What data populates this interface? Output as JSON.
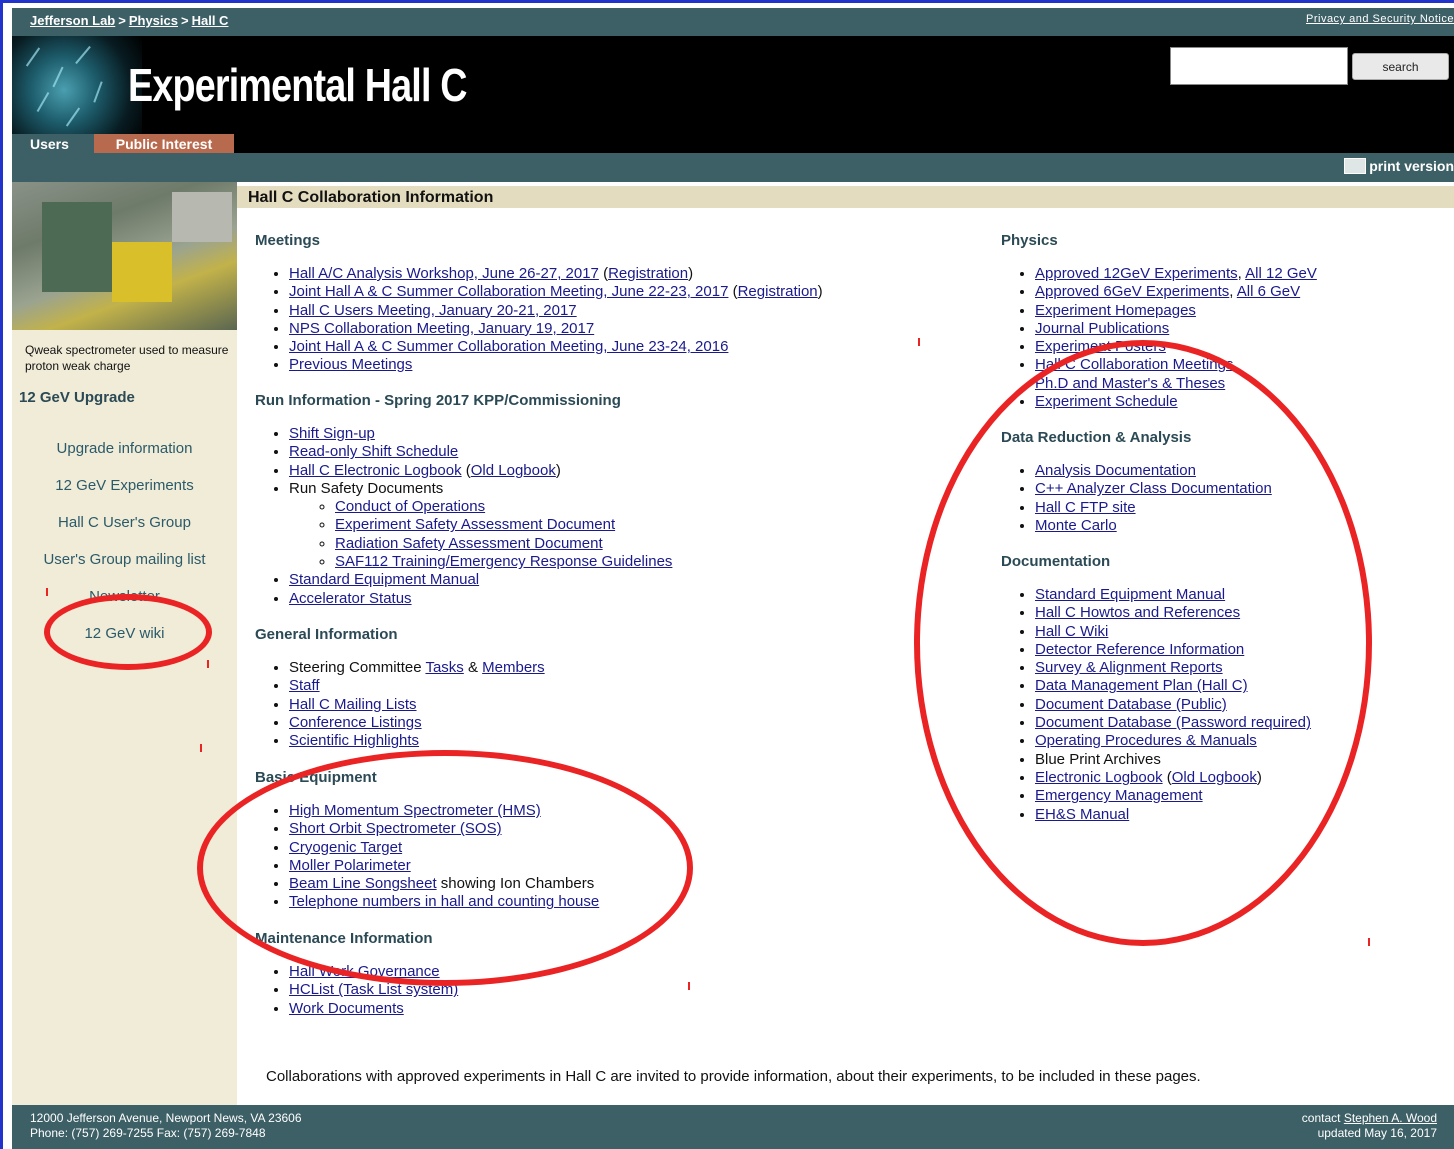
{
  "breadcrumb": {
    "items": [
      "Jefferson Lab",
      "Physics",
      "Hall C"
    ],
    "separator": ">"
  },
  "privacy_link": "Privacy and Security Notice",
  "site_title": "Experimental Hall C",
  "search": {
    "button_label": "search",
    "placeholder": ""
  },
  "tabs": [
    "Users",
    "Public Interest"
  ],
  "print_label": "print version",
  "sidebar": {
    "caption": "Qweak spectrometer used to measure proton weak charge",
    "heading": "12 GeV Upgrade",
    "links": [
      "Upgrade information",
      "12 GeV Experiments",
      "Hall C User's Group",
      "User's Group mailing list",
      "Newsletter",
      "12 GeV wiki"
    ]
  },
  "content_title": "Hall C Collaboration Information",
  "left": {
    "meetings": {
      "heading": "Meetings",
      "items": [
        [
          "Hall A/C Analysis Workshop, June 26-27, 2017",
          " (",
          "Registration",
          ")"
        ],
        [
          "Joint Hall A & C Summer Collaboration Meeting, June 22-23, 2017",
          " (",
          "Registration",
          ")"
        ],
        [
          "Hall C Users Meeting, January 20-21, 2017"
        ],
        [
          "NPS Collaboration Meeting, January 19, 2017"
        ],
        [
          "Joint Hall A & C Summer Collaboration Meeting, June 23-24, 2016"
        ],
        [
          "Previous Meetings"
        ]
      ]
    },
    "run": {
      "heading": "Run Information - Spring 2017 KPP/Commissioning",
      "items": [
        "Shift Sign-up",
        "Read-only Shift Schedule"
      ],
      "logbook": [
        "Hall C Electronic Logbook",
        "Old Logbook"
      ],
      "safety_label": "Run Safety Documents",
      "safety_items": [
        "Conduct of Operations",
        "Experiment Safety Assessment Document",
        "Radiation Safety Assessment Document",
        "SAF112 Training/Emergency Response Guidelines"
      ],
      "after": [
        "Standard Equipment Manual",
        "Accelerator Status"
      ]
    },
    "general": {
      "heading": "General Information",
      "steering": [
        "Steering Committee ",
        "Tasks",
        " & ",
        "Members"
      ],
      "items": [
        "Staff",
        "Hall C Mailing Lists",
        "Conference Listings",
        "Scientific Highlights"
      ]
    },
    "equipment": {
      "heading": "Basic Equipment",
      "items": [
        "High Momentum Spectrometer (HMS)",
        "Short Orbit Spectrometer (SOS)",
        "Cryogenic Target",
        "Moller Polarimeter"
      ],
      "beam": [
        "Beam Line Songsheet",
        " showing Ion Chambers"
      ],
      "phone": "Telephone numbers in hall and counting house"
    },
    "maintenance": {
      "heading": "Maintenance Information",
      "items": [
        "Hall Work Governance",
        "HCList (Task List system)",
        "Work Documents"
      ]
    }
  },
  "right": {
    "physics": {
      "heading": "Physics",
      "pairs": [
        [
          "Approved 12GeV Experiments",
          "All 12 GeV"
        ],
        [
          "Approved 6GeV Experiments",
          "All 6 GeV"
        ]
      ],
      "items": [
        "Experiment Homepages",
        "Journal Publications",
        "Experiment Posters",
        "Hall C Collaboration Meetings"
      ],
      "theses": "Ph.D and Master's & Theses",
      "schedule": "Experiment Schedule"
    },
    "analysis": {
      "heading": "Data Reduction & Analysis",
      "items": [
        "Analysis Documentation",
        "C++ Analyzer Class Documentation",
        "Hall C FTP site",
        "Monte Carlo"
      ]
    },
    "docs": {
      "heading": "Documentation",
      "items": [
        "Standard Equipment Manual",
        "Hall C Howtos and References",
        "Hall C Wiki",
        "Detector Reference Information",
        "Survey & Alignment Reports",
        "Data Management Plan (Hall C)",
        "Document Database (Public)",
        "Document Database (Password required)",
        "Operating Procedures & Manuals"
      ],
      "blueprint": "Blue Print Archives",
      "elog": [
        "Electronic Logbook",
        "Old Logbook"
      ],
      "tail": [
        "Emergency Management",
        "EH&S Manual"
      ]
    }
  },
  "note": "Collaborations with approved experiments in Hall C are invited to provide information, about their experiments, to be included in these pages.",
  "footer": {
    "address": "12000 Jefferson Avenue, Newport News, VA 23606",
    "phone": "Phone: (757) 269-7255 Fax: (757) 269-7848",
    "contact_prefix": "contact ",
    "contact_name": "Stephen A. Wood",
    "updated": "updated May 16, 2017"
  },
  "colors": {
    "teal": "#3d5f66",
    "tan": "#f1ecd7",
    "tab_accent": "#b86a4e",
    "annotation": "#ea2424",
    "link": "#1a1a8c"
  }
}
